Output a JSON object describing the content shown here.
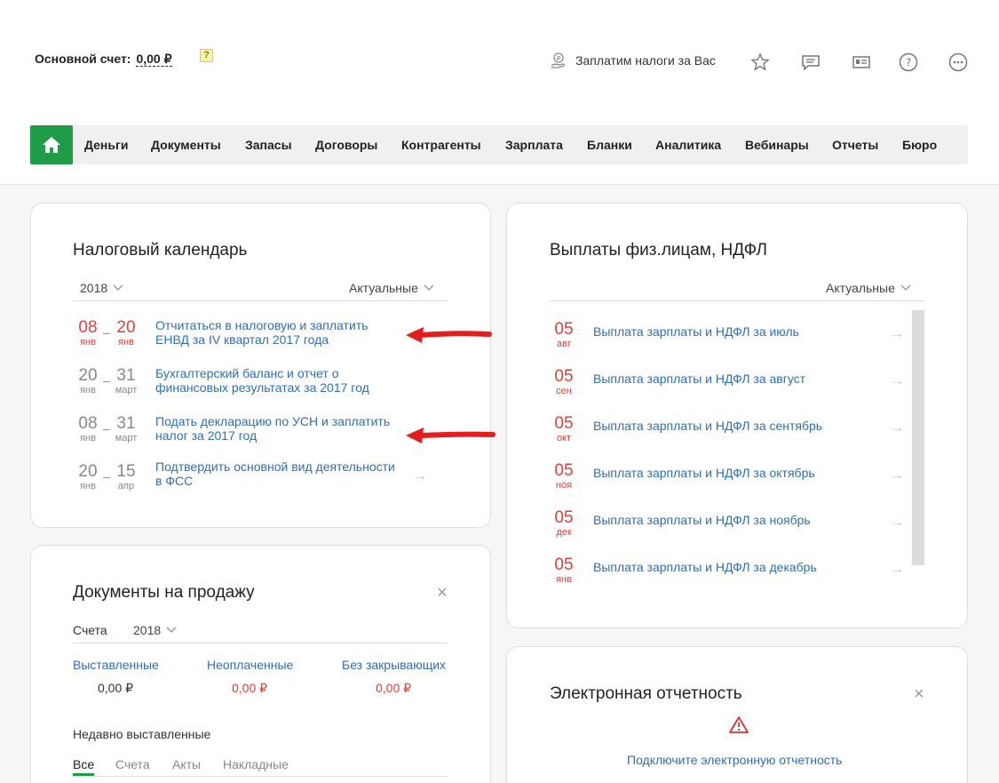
{
  "header": {
    "account_label": "Основной счет:",
    "account_value": "0,00 ₽",
    "hint_icon": "?",
    "taxpay_label": "Заплатим налоги за Вас",
    "icons": [
      "star-icon",
      "chat-icon",
      "card-icon",
      "help-icon",
      "more-icon"
    ]
  },
  "nav": {
    "home_icon": "home-icon",
    "items": [
      "Деньги",
      "Документы",
      "Запасы",
      "Договоры",
      "Контрагенты",
      "Зарплата",
      "Бланки",
      "Аналитика",
      "Вебинары",
      "Отчеты",
      "Бюро"
    ]
  },
  "tax_calendar": {
    "title": "Налоговый календарь",
    "year": "2018",
    "filter": "Актуальные",
    "items": [
      {
        "from_day": "08",
        "from_month": "янв",
        "to_day": "20",
        "to_month": "янв",
        "text": "Отчитаться в налоговую и заплатить ЕНВД за IV квартал 2017 года",
        "urgent": true
      },
      {
        "from_day": "20",
        "from_month": "янв",
        "to_day": "31",
        "to_month": "март",
        "text": "Бухгалтерский баланс и отчет о финансовых результатах за 2017 год",
        "urgent": false
      },
      {
        "from_day": "08",
        "from_month": "янв",
        "to_day": "31",
        "to_month": "март",
        "text": "Подать декларацию по УСН и заплатить налог за 2017 год",
        "urgent": false
      },
      {
        "from_day": "20",
        "from_month": "янв",
        "to_day": "15",
        "to_month": "апр",
        "text": "Подтвердить основной вид деятельности в ФСС",
        "urgent": false
      }
    ],
    "dash": "–",
    "row_arrow": "→"
  },
  "payments": {
    "title": "Выплаты физ.лицам, НДФЛ",
    "filter": "Актуальные",
    "items": [
      {
        "day": "05",
        "month": "авг",
        "text": "Выплата зарплаты и НДФЛ за июль"
      },
      {
        "day": "05",
        "month": "сен",
        "text": "Выплата зарплаты и НДФЛ за август"
      },
      {
        "day": "05",
        "month": "окт",
        "text": "Выплата зарплаты и НДФЛ за сентябрь"
      },
      {
        "day": "05",
        "month": "ноя",
        "text": "Выплата зарплаты и НДФЛ за октябрь"
      },
      {
        "day": "05",
        "month": "дек",
        "text": "Выплата зарплаты и НДФЛ за ноябрь"
      },
      {
        "day": "05",
        "month": "янв",
        "text": "Выплата зарплаты и НДФЛ за декабрь"
      }
    ],
    "row_arrow": "→"
  },
  "sale_docs": {
    "title": "Документы на продажу",
    "close": "×",
    "invoices_label": "Счета",
    "year": "2018",
    "cols": [
      {
        "label": "Выставленные",
        "amount": "0,00 ₽"
      },
      {
        "label": "Неоплаченные",
        "amount": "0,00 ₽"
      },
      {
        "label": "Без закрывающих",
        "amount": "0,00 ₽"
      }
    ],
    "recent_title": "Недавно выставленные",
    "tabs": [
      "Все",
      "Счета",
      "Акты",
      "Накладные"
    ]
  },
  "e_reporting": {
    "title": "Электронная отчетность",
    "close": "×",
    "link": "Подключите электронную отчетность"
  },
  "colors": {
    "accent": "#1f9d46",
    "link": "#2f6eb5",
    "urgent": "#e0403a",
    "annotation_arrow": "#e41e1e"
  }
}
